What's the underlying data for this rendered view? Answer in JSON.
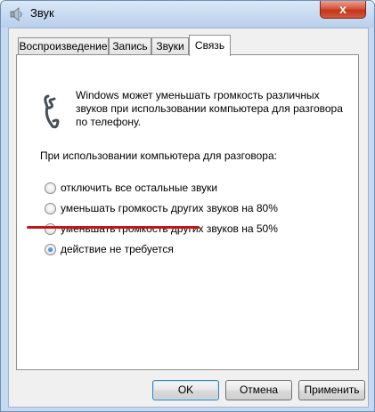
{
  "window": {
    "title": "Звук",
    "close_label": "x"
  },
  "tabs": [
    {
      "label": "Воспроизведение",
      "active": false
    },
    {
      "label": "Запись",
      "active": false
    },
    {
      "label": "Звуки",
      "active": false
    },
    {
      "label": "Связь",
      "active": true
    }
  ],
  "communications": {
    "description": "Windows может уменьшать громкость различных звуков при использовании компьютера для разговора по телефону.",
    "subheading": "При использовании компьютера для разговора:",
    "options": [
      {
        "label": "отключить все остальные звуки",
        "checked": false
      },
      {
        "label": "уменьшать громкость других звуков на 80%",
        "checked": false
      },
      {
        "label": "уменьшать громкость других звуков на 50%",
        "checked": false
      },
      {
        "label": "действие не требуется",
        "checked": true
      }
    ]
  },
  "buttons": {
    "ok": "OK",
    "cancel": "Отмена",
    "apply": "Применить"
  },
  "colors": {
    "annotation_underline": "#c81414",
    "window_frame": "#c5d9f0"
  }
}
